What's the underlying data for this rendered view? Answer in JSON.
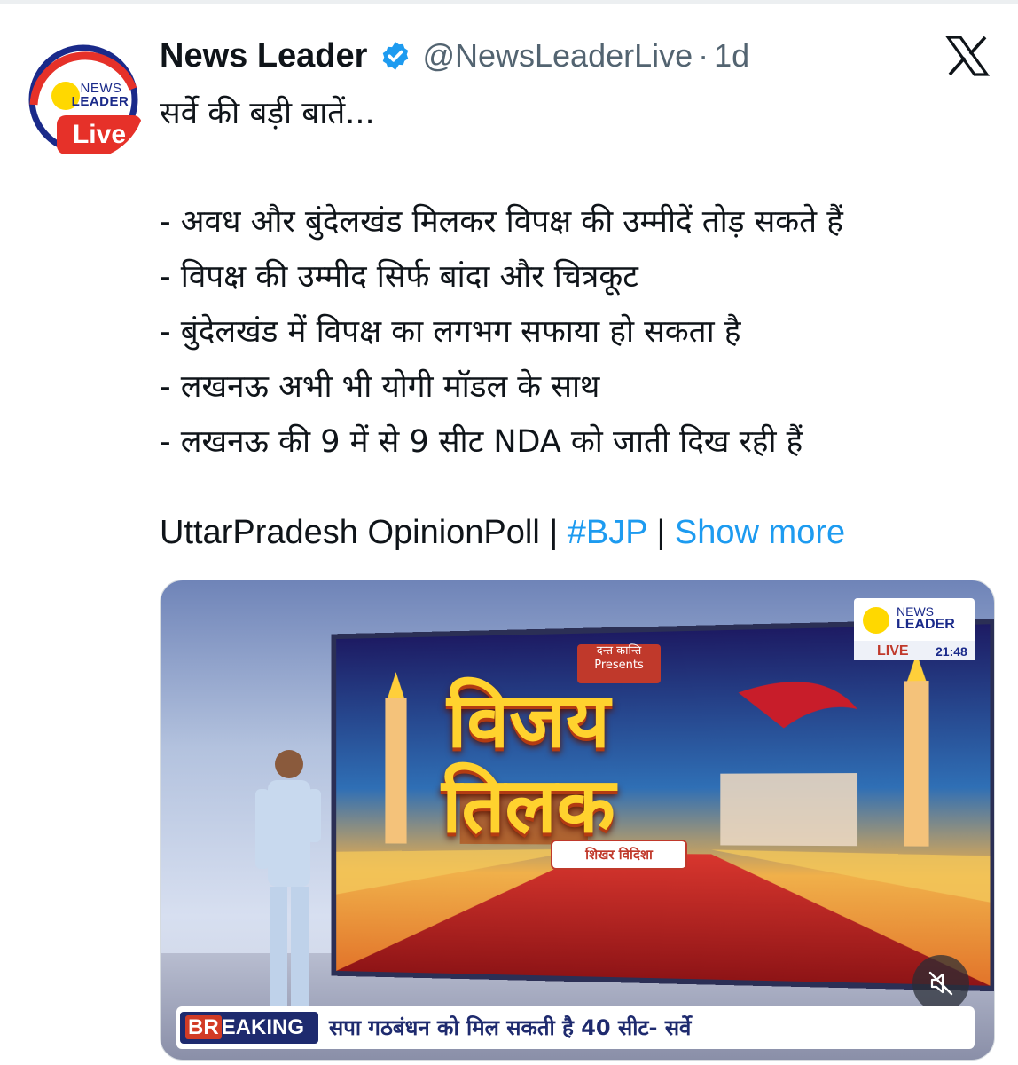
{
  "app": {
    "accent_color": "#1d9bf0"
  },
  "author": {
    "avatar": {
      "line1": "NEWS",
      "line2": "LEADER",
      "badge": "Live",
      "brand_color": "#e63129"
    },
    "name": "News Leader",
    "verified_icon": "verified-badge-icon",
    "handle": "@NewsLeaderLive",
    "separator": "·",
    "time": "1d"
  },
  "top_right_icon": "x-logo-icon",
  "tweet": {
    "lines": [
      "सर्वे की बड़ी बातें...",
      "- अवध और बुंदेलखंड मिलकर विपक्ष की उम्मीदें तोड़ सकते हैं",
      "- विपक्ष की उम्मीद सिर्फ बांदा और चित्रकूट",
      "- बुंदेलखंड में विपक्ष का लगभग सफाया हो सकता है",
      "- लखनऊ अभी भी योगी मॉडल के साथ",
      "- लखनऊ की 9 में से 9 सीट NDA को जाती दिख रही हैं"
    ],
    "tags_prefix": "UttarPradesh OpinionPoll | ",
    "hashtag": "#BJP",
    "tags_sep": " | ",
    "show_more": "Show more"
  },
  "media": {
    "channel_badge": {
      "line1": "NEWS",
      "line2": "LEADER",
      "live": "LIVE",
      "time": "21:48"
    },
    "screen_title": "विजय तिलक",
    "screen_sponsor_top": "दन्त कान्ति Presents",
    "screen_sponsor_bottom": "शिखर  विदिशा",
    "breaking_prefix": "BR",
    "breaking_suffix": "EAKING",
    "breaking_text": "सपा गठबंधन को मिल सकती है 40 सीट- सर्वे",
    "mute_icon": "muted-speaker-icon"
  }
}
